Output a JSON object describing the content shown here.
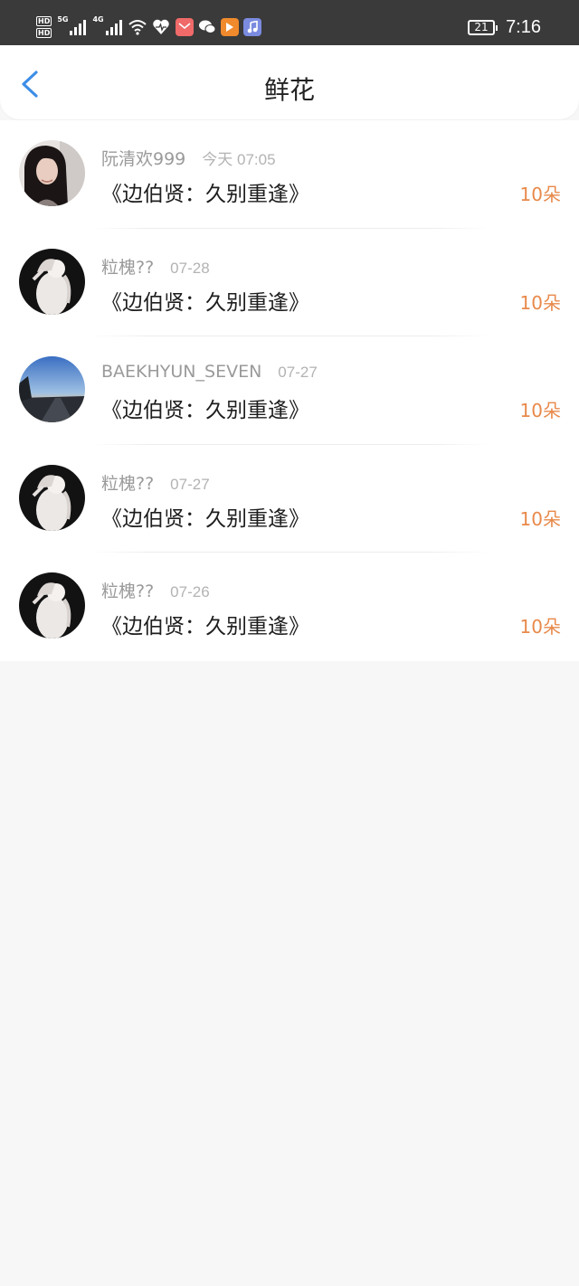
{
  "status_bar": {
    "hd_top": "HD",
    "hd_bottom": "HD",
    "net1": "5G",
    "net2": "4G",
    "battery": "21",
    "time": "7:16",
    "icons": [
      "signal-icon",
      "wifi-icon",
      "health-heart-icon",
      "mail-app-icon",
      "wechat-icon",
      "video-app-icon",
      "music-app-icon"
    ]
  },
  "header": {
    "title": "鲜花",
    "back_icon": "chevron-left-icon",
    "accent_color": "#3d8ee6"
  },
  "records": [
    {
      "user": "阮清欢999",
      "time": "今天 07:05",
      "book": "《边伯贤：久别重逢》",
      "count": "10朵",
      "avatar": "portrait-girl"
    },
    {
      "user": "粒槐??",
      "time": "07-28",
      "book": "《边伯贤：久别重逢》",
      "count": "10朵",
      "avatar": "white-dress-girl"
    },
    {
      "user": "BAEKHYUN_SEVEN",
      "time": "07-27",
      "book": "《边伯贤：久别重逢》",
      "count": "10朵",
      "avatar": "sunset-road"
    },
    {
      "user": "粒槐??",
      "time": "07-27",
      "book": "《边伯贤：久别重逢》",
      "count": "10朵",
      "avatar": "white-dress-girl"
    },
    {
      "user": "粒槐??",
      "time": "07-26",
      "book": "《边伯贤：久别重逢》",
      "count": "10朵",
      "avatar": "white-dress-girl"
    }
  ],
  "colors": {
    "count": "#e8894a",
    "username": "#9a9a9a",
    "page_bg": "#f7f7f7"
  }
}
